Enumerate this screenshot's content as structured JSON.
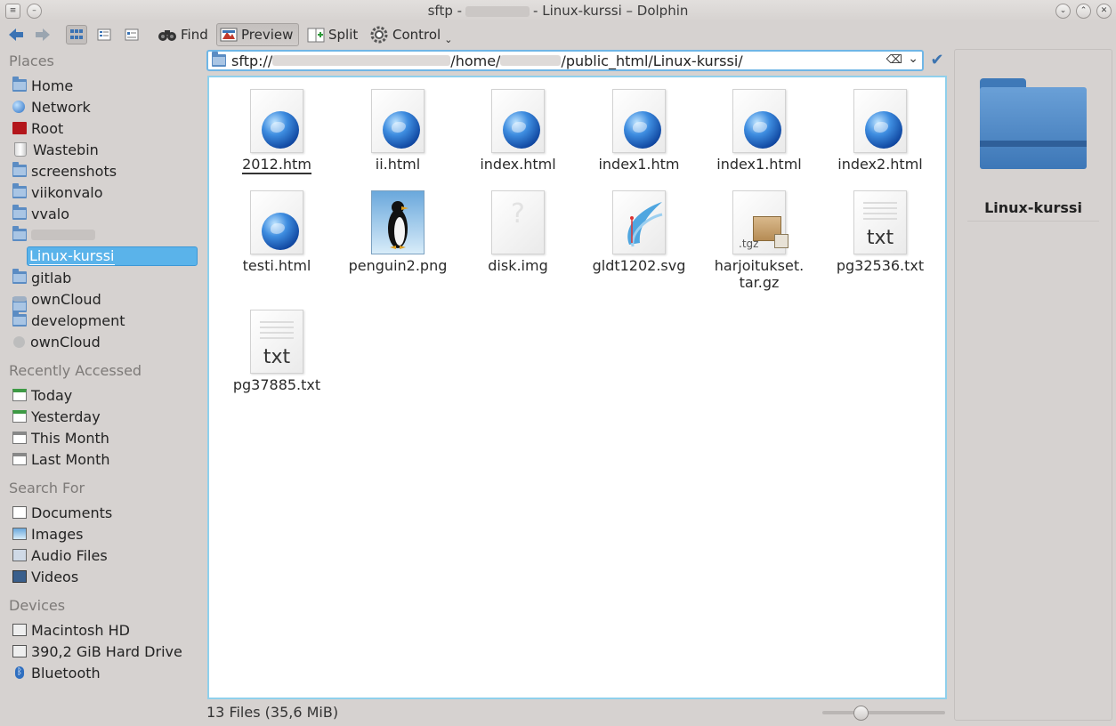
{
  "window": {
    "title_prefix": "sftp -",
    "title_suffix": "- Linux-kurssi – Dolphin"
  },
  "toolbar": {
    "find_label": "Find",
    "preview_label": "Preview",
    "split_label": "Split",
    "control_label": "Control"
  },
  "location": {
    "scheme": "sftp://",
    "mid": "/home/",
    "tail": "/public_html/Linux-kurssi/"
  },
  "sidebar": {
    "places_header": "Places",
    "places": [
      "Home",
      "Network",
      "Root",
      "Wastebin",
      "screenshots",
      "viikonvalo",
      "vvalo",
      "",
      "Linux-kurssi",
      "gitlab",
      "ownCloud",
      "development",
      "ownCloud"
    ],
    "recent_header": "Recently Accessed",
    "recent": [
      "Today",
      "Yesterday",
      "This Month",
      "Last Month"
    ],
    "search_header": "Search For",
    "search": [
      "Documents",
      "Images",
      "Audio Files",
      "Videos"
    ],
    "devices_header": "Devices",
    "devices": [
      "Macintosh HD",
      "390,2 GiB Hard Drive",
      "Bluetooth"
    ]
  },
  "files": [
    {
      "name": "2012.htm",
      "icon": "html-globe-icon"
    },
    {
      "name": "ii.html",
      "icon": "html-globe-icon"
    },
    {
      "name": "index.html",
      "icon": "html-globe-icon"
    },
    {
      "name": "index1.htm",
      "icon": "html-globe-icon"
    },
    {
      "name": "index1.html",
      "icon": "html-globe-icon"
    },
    {
      "name": "index2.html",
      "icon": "html-globe-icon"
    },
    {
      "name": "testi.html",
      "icon": "html-globe-icon"
    },
    {
      "name": "penguin2.png",
      "icon": "penguin-image-icon"
    },
    {
      "name": "disk.img",
      "icon": "unknown-file-icon"
    },
    {
      "name": "gldt1202.svg",
      "icon": "svg-image-icon"
    },
    {
      "name": "harjoitukset.\ntar.gz",
      "icon": "tgz-archive-icon",
      "badge": ".tgz"
    },
    {
      "name": "pg32536.txt",
      "icon": "text-file-icon",
      "badge": "txt"
    },
    {
      "name": "pg37885.txt",
      "icon": "text-file-icon",
      "badge": "txt"
    }
  ],
  "status": {
    "summary": "13 Files (35,6 MiB)"
  },
  "preview": {
    "name": "Linux-kurssi"
  }
}
